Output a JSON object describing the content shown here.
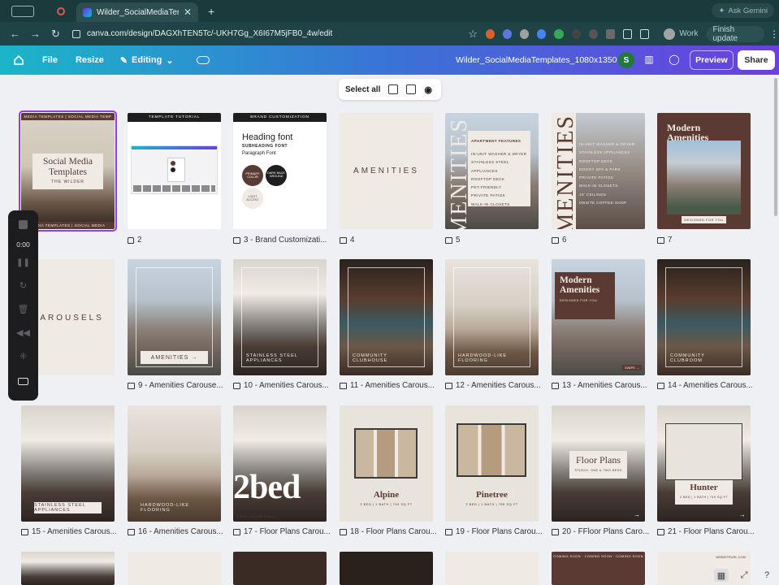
{
  "browser": {
    "tab_title": "Wilder_SocialMediaTemplate",
    "url": "canva.com/design/DAGXhTEN5Tc/-UKH7Gg_X6I67M5jFB0_4w/edit",
    "ask_gemini": "Ask Gemini",
    "profile": "Work",
    "finish_update": "Finish update"
  },
  "canva": {
    "file": "File",
    "resize": "Resize",
    "editing": "Editing",
    "doc_title": "Wilder_SocialMediaTemplates_1080x1350",
    "avatar_initial": "S",
    "preview": "Preview",
    "share": "Share"
  },
  "toolbar": {
    "select_all": "Select all"
  },
  "recorder": {
    "time": "0:00"
  },
  "pages": [
    {
      "label": "",
      "thumb": {
        "strip_top": "MEDIA TEMPLATES | SOCIAL MEDIA TEMP",
        "title": "Social Media Templates",
        "sub": "THE WILDER",
        "strip_bottom": "MEDIA TEMPLATES | SOCIAL MEDIA"
      }
    },
    {
      "label": "2",
      "thumb": {
        "head": "TEMPLATE TUTORIAL"
      }
    },
    {
      "label": "3 - Brand Customizati...",
      "thumb": {
        "head": "BRAND CUSTOMIZATION",
        "heading": "Heading font",
        "sub": "SUBHEADING FONT",
        "para": "Paragraph Font",
        "c1": "PRIMARY COLOR",
        "c2": "DARK BACK GROUND",
        "c3": "LIGHT ACCENT"
      }
    },
    {
      "label": "4",
      "thumb": {
        "title": "AMENITIES"
      }
    },
    {
      "label": "5",
      "thumb": {
        "vert": "AMENITIES",
        "head": "APARTMENT FEATURES",
        "items": [
          "IN-UNIT WASHER & DRYER",
          "STAINLESS STEEL APPLIANCES",
          "ROOFTOP DECK",
          "PET-FRIENDLY",
          "PRIVATE PATIOS",
          "WALK-IN CLOSETS"
        ]
      }
    },
    {
      "label": "6",
      "thumb": {
        "vert": "AMENITIES",
        "items": [
          "IN-UNIT WASHER & DRYER",
          "STAINLESS APPLIANCES",
          "ROOFTOP DECK",
          "DOGGY SPA & PARK",
          "PRIVATE PATIOS",
          "WALK-IN CLOSETS",
          "10' CEILINGS",
          "ONSITE COFFEE SHOP"
        ]
      }
    },
    {
      "label": "7",
      "thumb": {
        "title": "Modern Amenities",
        "tag": "DESIGNED FOR YOU"
      }
    },
    {
      "label": "",
      "thumb": {
        "title": "CAROUSELS"
      }
    },
    {
      "label": "9 - Amenities Carouse...",
      "thumb": {
        "caption": "AMENITIES →"
      }
    },
    {
      "label": "10 - Amenities Carous...",
      "thumb": {
        "caption": "STAINLESS STEEL APPLIANCES"
      }
    },
    {
      "label": "11 - Amenities Carous...",
      "thumb": {
        "caption": "COMMUNITY CLUBHOUSE"
      }
    },
    {
      "label": "12 - Amenities Carous...",
      "thumb": {
        "caption": "HARDWOOD-LIKE FLOORING"
      }
    },
    {
      "label": "13 - Amenities Carous...",
      "thumb": {
        "title": "Modern Amenities",
        "tag": "DESIGNED FOR YOU",
        "swipe": "SWIPE →"
      }
    },
    {
      "label": "14 - Amenities Carous...",
      "thumb": {
        "caption": "COMMUNITY CLUBROOM"
      }
    },
    {
      "label": "15 - Amenities Carous...",
      "thumb": {
        "caption": "STAINLESS STEEL APPLIANCES"
      }
    },
    {
      "label": "16 - Amenities Carous...",
      "thumb": {
        "caption": "HARDWOOD-LIKE FLOORING"
      }
    },
    {
      "label": "17 - Floor Plans Carou...",
      "thumb": {
        "big": "2bed",
        "caption": "2 BED FLOOR PLANS"
      }
    },
    {
      "label": "18 - Floor Plans Carou...",
      "thumb": {
        "title": "Alpine",
        "sub": "2 BED | 1 BATH | 749 SQ FT"
      }
    },
    {
      "label": "19 - Floor Plans Carou...",
      "thumb": {
        "title": "Pinetree",
        "sub": "2 BED | 1 BATH | 785 SQ FT"
      }
    },
    {
      "label": "20 - FFloor Plans Caro...",
      "thumb": {
        "title": "Floor Plans",
        "sub": "STUDIO, ONE & TWO BEDS"
      }
    },
    {
      "label": "21 - Floor Plans Carou...",
      "thumb": {
        "title": "Hunter",
        "sub": "2 BED | 1 BATH | 749 SQ FT"
      }
    },
    {
      "label": "",
      "thumb": {}
    },
    {
      "label": "",
      "thumb": {}
    },
    {
      "label": "",
      "thumb": {}
    },
    {
      "label": "",
      "thumb": {}
    },
    {
      "label": "",
      "thumb": {}
    },
    {
      "label": "",
      "thumb": {
        "strip": "COMING SOON · COMING SOON · COMING SOON"
      }
    },
    {
      "label": "",
      "thumb": {
        "strip": "WEBSITEURL.COM"
      }
    }
  ],
  "colors": {
    "brand_brown": "#5b3a33",
    "beige": "#efebe4",
    "selection": "#8b3dff"
  }
}
